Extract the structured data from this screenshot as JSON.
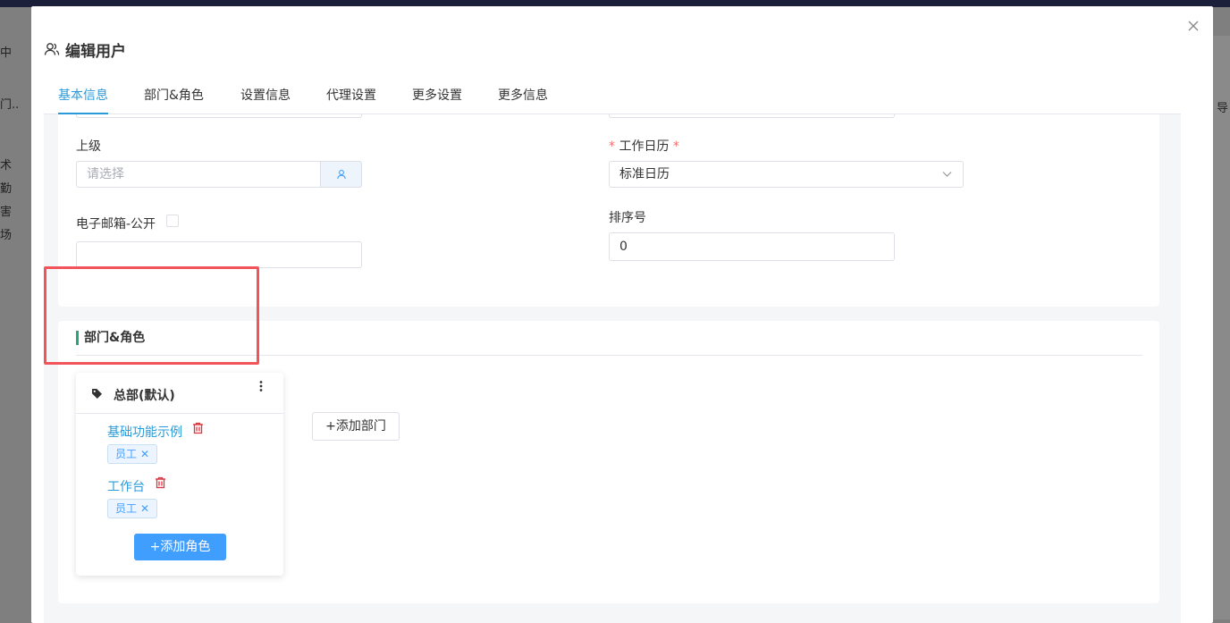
{
  "dialog": {
    "title": "编辑用户"
  },
  "tabs": [
    {
      "label": "基本信息",
      "active": true
    },
    {
      "label": "部门&角色",
      "active": false
    },
    {
      "label": "设置信息",
      "active": false
    },
    {
      "label": "代理设置",
      "active": false
    },
    {
      "label": "更多设置",
      "active": false
    },
    {
      "label": "更多信息",
      "active": false
    }
  ],
  "form": {
    "superior": {
      "label": "上级",
      "placeholder": "请选择"
    },
    "calendar": {
      "label": "工作日历",
      "required_mark": "*",
      "value": "标准日历"
    },
    "email": {
      "label": "电子邮箱-公开",
      "value": ""
    },
    "sort": {
      "label": "排序号",
      "value": "0"
    }
  },
  "dept_roles": {
    "section_title": "部门&角色",
    "department": {
      "name": "总部(默认)",
      "roles": [
        {
          "name": "基础功能示例",
          "tag": "员工",
          "tag_close": "✕"
        },
        {
          "name": "工作台",
          "tag": "员工",
          "tag_close": "✕"
        }
      ],
      "add_role_label": "+添加角色"
    },
    "add_dept_label": "+添加部门"
  },
  "background": {
    "left_fragments": [
      "中",
      "门..",
      "术",
      "勤",
      "害",
      "场"
    ],
    "right_fragment": "导"
  },
  "colors": {
    "accent": "#2a9bd8",
    "primary": "#409eff",
    "required": "#f56c6c",
    "highlight_box": "#f2545b",
    "section_bar": "#2aa57a",
    "delete_icon": "#e0343c"
  }
}
